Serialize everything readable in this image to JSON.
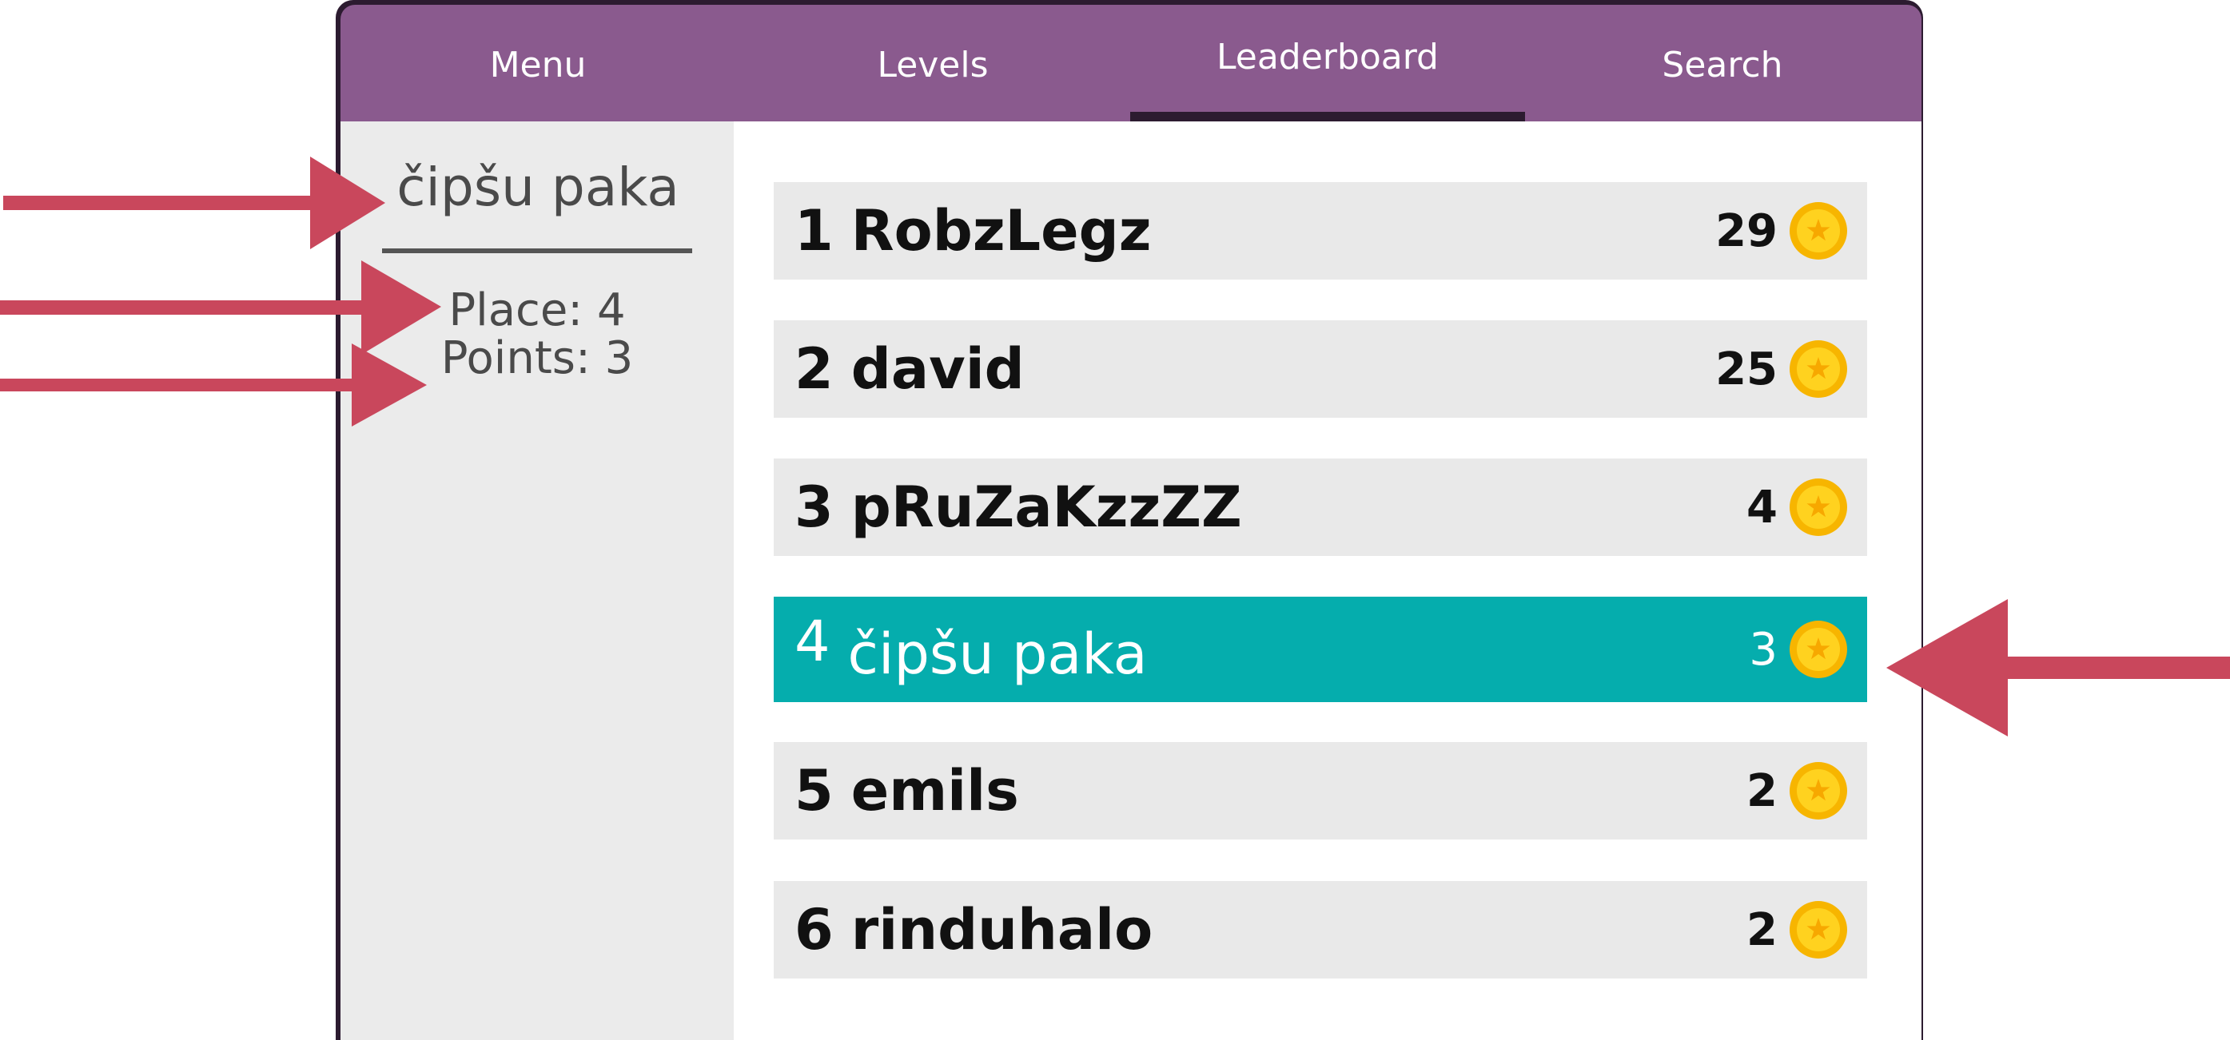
{
  "nav": {
    "tabs": [
      {
        "label": "Menu",
        "active": false
      },
      {
        "label": "Levels",
        "active": false
      },
      {
        "label": "Leaderboard",
        "active": true
      },
      {
        "label": "Search",
        "active": false
      }
    ]
  },
  "profile": {
    "name": "čipšu paka",
    "place": "Place: 4",
    "points": "Points: 3"
  },
  "leaderboard": {
    "rows": [
      {
        "rank": "1",
        "name": "RobzLegz",
        "score": "29",
        "highlighted": false
      },
      {
        "rank": "2",
        "name": "david",
        "score": "25",
        "highlighted": false
      },
      {
        "rank": "3",
        "name": "pRuZaKzzZZ",
        "score": "4",
        "highlighted": false
      },
      {
        "rank": "4",
        "name": "čipšu paka",
        "score": "3",
        "highlighted": true
      },
      {
        "rank": "5",
        "name": "emils",
        "score": "2",
        "highlighted": false
      },
      {
        "rank": "6",
        "name": "rinduhalo",
        "score": "2",
        "highlighted": false
      }
    ]
  },
  "colors": {
    "nav": "#8a5a8e",
    "frame": "#2c1b30",
    "sidebar": "#ebebeb",
    "row": "#e9e9e9",
    "highlight": "#05adad",
    "arrow": "#c9475c",
    "coin": "#f7b500"
  },
  "icons": {
    "coin": "coin-icon",
    "arrow": "pointer-arrow"
  }
}
